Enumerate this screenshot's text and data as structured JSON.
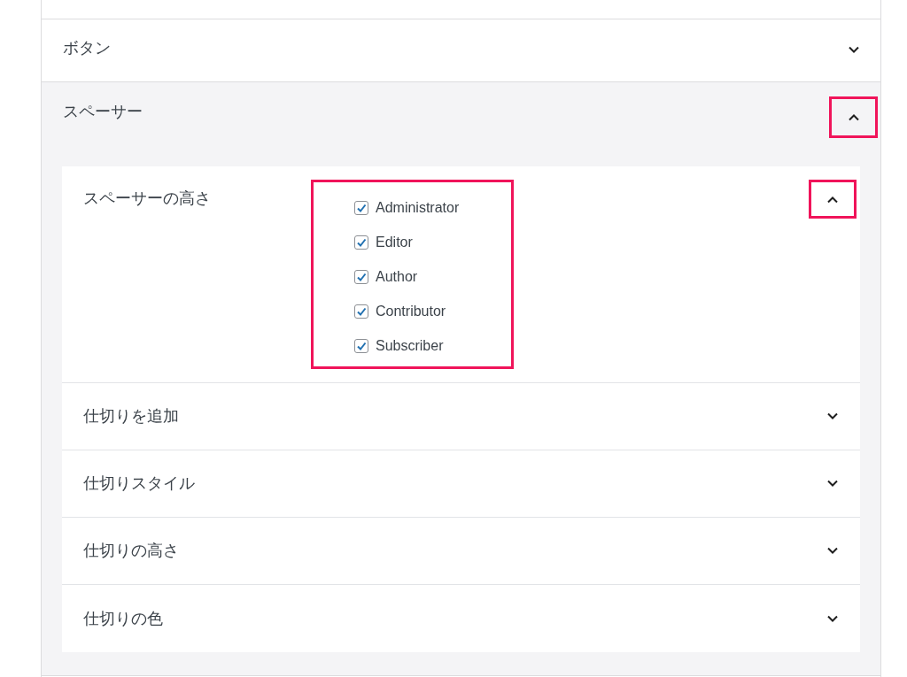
{
  "sections": [
    {
      "title": "ボタン",
      "expanded": false,
      "highlighted": false
    },
    {
      "title": "スペーサー",
      "expanded": true,
      "highlighted": true,
      "settings": [
        {
          "title": "スペーサーの高さ",
          "expanded": true,
          "highlighted": true,
          "roles": {
            "highlighted": true,
            "items": [
              {
                "label": "Administrator",
                "checked": true
              },
              {
                "label": "Editor",
                "checked": true
              },
              {
                "label": "Author",
                "checked": true
              },
              {
                "label": "Contributor",
                "checked": true
              },
              {
                "label": "Subscriber",
                "checked": true
              }
            ]
          }
        },
        {
          "title": "仕切りを追加",
          "expanded": false,
          "highlighted": false
        },
        {
          "title": "仕切りスタイル",
          "expanded": false,
          "highlighted": false
        },
        {
          "title": "仕切りの高さ",
          "expanded": false,
          "highlighted": false
        },
        {
          "title": "仕切りの色",
          "expanded": false,
          "highlighted": false
        }
      ]
    }
  ]
}
